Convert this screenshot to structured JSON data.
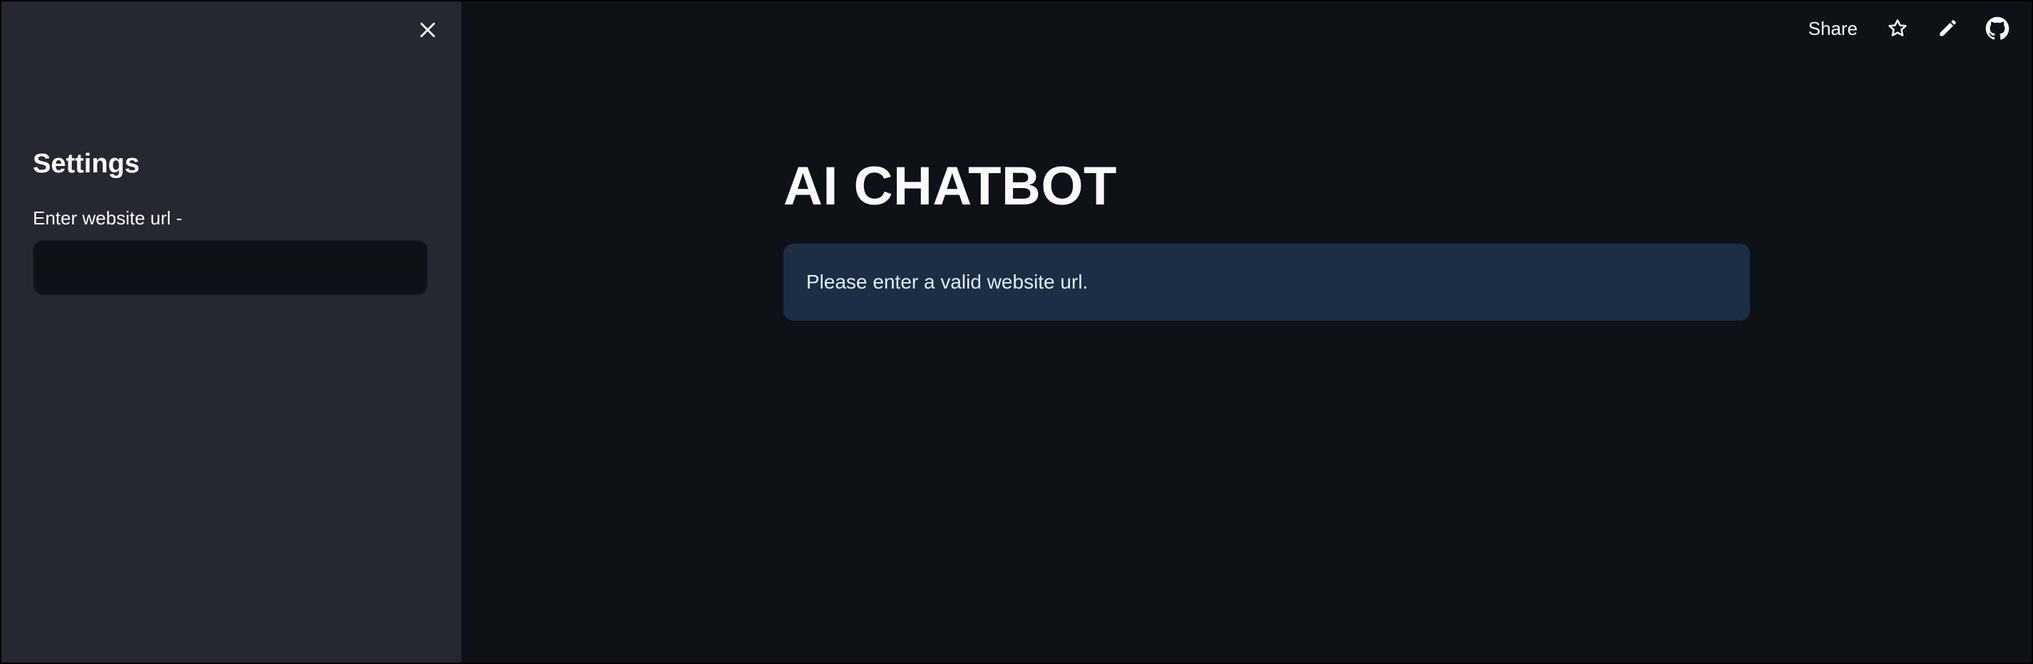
{
  "sidebar": {
    "title": "Settings",
    "url_field": {
      "label": "Enter website url -",
      "value": "",
      "placeholder": ""
    },
    "close_icon": "close-icon"
  },
  "toolbar": {
    "share_label": "Share",
    "icons": [
      "star-icon",
      "pencil-icon",
      "github-icon"
    ]
  },
  "main": {
    "title": "AI CHATBOT",
    "info_message": "Please enter a valid website url."
  },
  "colors": {
    "sidebar_bg": "#262730",
    "main_bg": "#0e1117",
    "info_bg": "#1c2e44",
    "text": "#fafafa"
  }
}
